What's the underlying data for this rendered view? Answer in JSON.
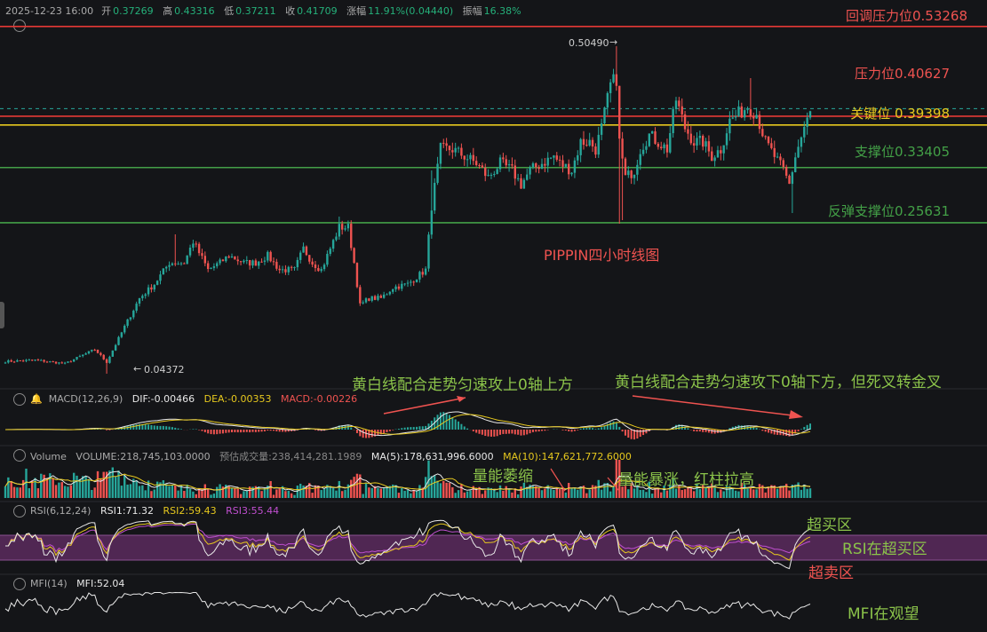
{
  "header": {
    "time": "2025-12-23 16:00",
    "open_label": "开",
    "open": "0.37269",
    "high_label": "高",
    "high": "0.43316",
    "low_label": "低",
    "low": "0.37211",
    "close_label": "收",
    "close": "0.41709",
    "change_label": "涨幅",
    "change": "11.91%(0.04440)",
    "amp_label": "振幅",
    "amp": "16.38%"
  },
  "colors": {
    "up": "#26a69a",
    "down": "#ef5350",
    "resistance": "#e53935",
    "key": "#e6c81e",
    "support": "#43a047",
    "dif": "#e8e8e8",
    "dea": "#e6c81e",
    "rsi_band": "#5a2a5e",
    "annotation_green": "#8bc34a"
  },
  "chart_data": [
    {
      "type": "candlestick",
      "title": "PIPPIN四小时线图",
      "xlabel": "",
      "ylabel": "",
      "ylim": [
        0.02,
        0.545
      ],
      "grid": false,
      "price_labels": {
        "high": "0.50490",
        "low": "0.04372"
      },
      "levels": [
        {
          "label": "回调压力位0.53268",
          "value": 0.53268,
          "color": "#e53935"
        },
        {
          "label": "压力位0.40627",
          "value": 0.40627,
          "color": "#e53935"
        },
        {
          "label": "关键位 0.39398",
          "value": 0.39398,
          "color": "#e6c81e"
        },
        {
          "label": "支撑位0.33405",
          "value": 0.33405,
          "color": "#43a047"
        },
        {
          "label": "反弹支撑位0.25631",
          "value": 0.25631,
          "color": "#43a047"
        }
      ],
      "close_anchors": [
        [
          0,
          0.061
        ],
        [
          10,
          0.063
        ],
        [
          20,
          0.058
        ],
        [
          25,
          0.068
        ],
        [
          30,
          0.078
        ],
        [
          34,
          0.06
        ],
        [
          40,
          0.11
        ],
        [
          45,
          0.15
        ],
        [
          50,
          0.17
        ],
        [
          55,
          0.2
        ],
        [
          60,
          0.2
        ],
        [
          63,
          0.23
        ],
        [
          68,
          0.19
        ],
        [
          72,
          0.2
        ],
        [
          75,
          0.21
        ],
        [
          80,
          0.2
        ],
        [
          84,
          0.2
        ],
        [
          88,
          0.21
        ],
        [
          92,
          0.19
        ],
        [
          97,
          0.19
        ],
        [
          100,
          0.22
        ],
        [
          103,
          0.2
        ],
        [
          106,
          0.19
        ],
        [
          109,
          0.22
        ],
        [
          112,
          0.25
        ],
        [
          115,
          0.25
        ],
        [
          117,
          0.2
        ],
        [
          119,
          0.14
        ],
        [
          122,
          0.15
        ],
        [
          126,
          0.15
        ],
        [
          130,
          0.165
        ],
        [
          135,
          0.17
        ],
        [
          138,
          0.18
        ],
        [
          141,
          0.19
        ],
        [
          143,
          0.28
        ],
        [
          146,
          0.36
        ],
        [
          150,
          0.36
        ],
        [
          154,
          0.35
        ],
        [
          158,
          0.34
        ],
        [
          162,
          0.32
        ],
        [
          166,
          0.34
        ],
        [
          170,
          0.33
        ],
        [
          173,
          0.31
        ],
        [
          176,
          0.33
        ],
        [
          180,
          0.34
        ],
        [
          184,
          0.35
        ],
        [
          186,
          0.34
        ],
        [
          190,
          0.33
        ],
        [
          193,
          0.37
        ],
        [
          196,
          0.37
        ],
        [
          198,
          0.36
        ],
        [
          200,
          0.39
        ],
        [
          203,
          0.45
        ],
        [
          205,
          0.46
        ],
        [
          206,
          0.37
        ],
        [
          208,
          0.32
        ],
        [
          211,
          0.33
        ],
        [
          213,
          0.36
        ],
        [
          216,
          0.38
        ],
        [
          219,
          0.37
        ],
        [
          222,
          0.36
        ],
        [
          225,
          0.43
        ],
        [
          228,
          0.39
        ],
        [
          231,
          0.37
        ],
        [
          234,
          0.37
        ],
        [
          237,
          0.35
        ],
        [
          240,
          0.36
        ],
        [
          243,
          0.4
        ],
        [
          246,
          0.41
        ],
        [
          249,
          0.42
        ],
        [
          252,
          0.41
        ],
        [
          255,
          0.37
        ],
        [
          258,
          0.35
        ],
        [
          261,
          0.33
        ],
        [
          263,
          0.31
        ],
        [
          265,
          0.35
        ],
        [
          268,
          0.39
        ],
        [
          270,
          0.41
        ]
      ]
    },
    {
      "type": "line",
      "name_label": "MACD(12,26,9)",
      "legend": [
        {
          "label": "DIF:-0.00466",
          "color": "#e8e8e8"
        },
        {
          "label": "DEA:-0.00353",
          "color": "#e6c81e"
        },
        {
          "label": "MACD:-0.00226",
          "color": "#ef5350"
        }
      ],
      "annotations": [
        {
          "text": "黄白线配合走势匀速攻上0轴上方",
          "color": "#8bc34a"
        },
        {
          "text": "黄白线配合走势匀速攻下0轴下方，但死叉转金叉",
          "color": "#8bc34a"
        }
      ]
    },
    {
      "type": "bar",
      "name_label": "Volume",
      "legend": [
        {
          "label": "VOLUME:218,745,103.0000",
          "color": "#aaaaaa"
        },
        {
          "label": "预估成交量:238,414,281.1989",
          "color": "#888888"
        },
        {
          "label": "MA(5):178,631,996.6000",
          "color": "#e8e8e8"
        },
        {
          "label": "MA(10):147,621,772.6000",
          "color": "#e6c81e"
        }
      ],
      "annotations": [
        {
          "text": "量能萎缩",
          "color": "#8bc34a"
        },
        {
          "text": "量能暴涨，红柱拉高",
          "color": "#8bc34a"
        }
      ]
    },
    {
      "type": "line",
      "name_label": "RSI(6,12,24)",
      "legend": [
        {
          "label": "RSI1:71.32",
          "color": "#e8e8e8"
        },
        {
          "label": "RSI2:59.43",
          "color": "#e6c81e"
        },
        {
          "label": "RSI3:55.44",
          "color": "#c04fd0"
        }
      ],
      "annotations": [
        {
          "text": "超买区",
          "color": "#8bc34a"
        },
        {
          "text": "RSI在超买区",
          "color": "#8bc34a"
        },
        {
          "text": "超卖区",
          "color": "#ef5350"
        }
      ]
    },
    {
      "type": "line",
      "name_label": "MFI(14)",
      "legend": [
        {
          "label": "MFI:52.04",
          "color": "#e8e8e8"
        }
      ],
      "annotations": [
        {
          "text": "MFI在观望",
          "color": "#8bc34a"
        }
      ]
    }
  ]
}
